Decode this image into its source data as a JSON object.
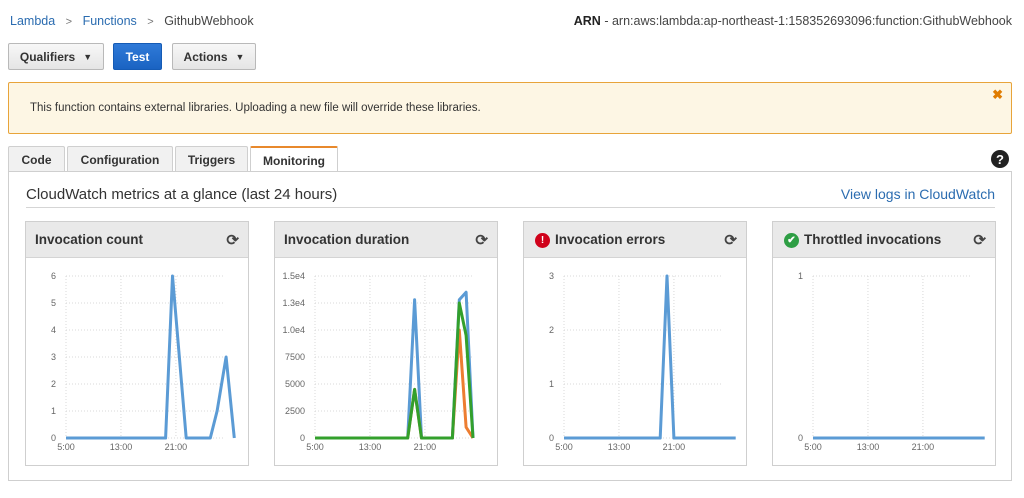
{
  "breadcrumb": {
    "items": [
      "Lambda",
      "Functions",
      "GithubWebhook"
    ]
  },
  "arn": {
    "label": "ARN",
    "value": " - arn:aws:lambda:ap-northeast-1:158352693096:function:GithubWebhook"
  },
  "toolbar": {
    "qualifiers_label": "Qualifiers",
    "test_label": "Test",
    "actions_label": "Actions"
  },
  "alert": {
    "message": "This function contains external libraries. Uploading a new file will override these libraries.",
    "close_glyph": "✖"
  },
  "tabs": [
    {
      "label": "Code",
      "active": false
    },
    {
      "label": "Configuration",
      "active": false
    },
    {
      "label": "Triggers",
      "active": false
    },
    {
      "label": "Monitoring",
      "active": true
    }
  ],
  "help_glyph": "?",
  "monitoring": {
    "title": "CloudWatch metrics at a glance (last 24 hours)",
    "logs_link": "View logs in CloudWatch"
  },
  "colors": {
    "blue": "#5b9bd5",
    "orange": "#ed7d31",
    "green": "#33a02c",
    "accent": "#e8892c"
  },
  "chart_data": [
    {
      "type": "line",
      "title": "Invocation count",
      "status_icon": null,
      "refresh_icon": "refresh-icon",
      "ylim": [
        0,
        6
      ],
      "y_ticks": [
        0,
        1,
        2,
        3,
        4,
        5,
        6
      ],
      "y_tick_labels": [
        "0",
        "1",
        "2",
        "3",
        "4",
        "5",
        "6"
      ],
      "x_ticks": [
        "5:00",
        "13:00",
        "21:00"
      ],
      "x_tick_hours": [
        5,
        13,
        21
      ],
      "xlim": [
        5,
        28
      ],
      "series": [
        {
          "color": "#5b9bd5",
          "x": [
            5,
            10,
            14.5,
            19.5,
            20.5,
            22.5,
            26,
            27,
            28.3,
            29.5
          ],
          "y": [
            0,
            0,
            0,
            0,
            6,
            0,
            0,
            1,
            3,
            0
          ]
        }
      ]
    },
    {
      "type": "line",
      "title": "Invocation duration",
      "status_icon": null,
      "refresh_icon": "refresh-icon",
      "ylim": [
        0,
        15000
      ],
      "y_ticks": [
        0,
        2500,
        5000,
        7500,
        10000,
        12500,
        15000
      ],
      "y_tick_labels": [
        "0",
        "2500",
        "5000",
        "7500",
        "1.0e4",
        "1.3e4",
        "1.5e4"
      ],
      "x_ticks": [
        "5:00",
        "13:00",
        "21:00"
      ],
      "x_tick_hours": [
        5,
        13,
        21
      ],
      "xlim": [
        5,
        28
      ],
      "series": [
        {
          "color": "#5b9bd5",
          "x": [
            5,
            12,
            18.5,
            19.5,
            20.5,
            25,
            26,
            27,
            28
          ],
          "y": [
            0,
            0,
            0,
            12800,
            0,
            0,
            12800,
            13500,
            0
          ]
        },
        {
          "color": "#ed7d31",
          "x": [
            5,
            12,
            18.5,
            19.5,
            20.5,
            25,
            26,
            27,
            28
          ],
          "y": [
            0,
            0,
            0,
            4500,
            0,
            0,
            10000,
            1000,
            0
          ]
        },
        {
          "color": "#33a02c",
          "x": [
            5,
            12,
            18.5,
            19.5,
            20.5,
            25,
            26,
            27,
            28
          ],
          "y": [
            0,
            0,
            0,
            4500,
            0,
            0,
            12500,
            9500,
            0
          ]
        }
      ]
    },
    {
      "type": "line",
      "title": "Invocation errors",
      "status_icon": "error",
      "status_glyph": "!",
      "refresh_icon": "refresh-icon",
      "ylim": [
        0,
        3
      ],
      "y_ticks": [
        0,
        1,
        2,
        3
      ],
      "y_tick_labels": [
        "0",
        "1",
        "2",
        "3"
      ],
      "x_ticks": [
        "5:00",
        "13:00",
        "21:00"
      ],
      "x_tick_hours": [
        5,
        13,
        21
      ],
      "xlim": [
        5,
        28
      ],
      "series": [
        {
          "color": "#5b9bd5",
          "x": [
            5,
            12,
            19,
            20,
            21,
            25,
            30
          ],
          "y": [
            0,
            0,
            0,
            3,
            0,
            0,
            0
          ]
        }
      ]
    },
    {
      "type": "line",
      "title": "Throttled invocations",
      "status_icon": "ok",
      "status_glyph": "✔",
      "refresh_icon": "refresh-icon",
      "ylim": [
        0,
        1
      ],
      "y_ticks": [
        0,
        1
      ],
      "y_tick_labels": [
        "0",
        "1"
      ],
      "x_ticks": [
        "5:00",
        "13:00",
        "21:00"
      ],
      "x_tick_hours": [
        5,
        13,
        21
      ],
      "xlim": [
        5,
        28
      ],
      "series": [
        {
          "color": "#5b9bd5",
          "x": [
            5,
            30
          ],
          "y": [
            0,
            0
          ]
        }
      ]
    }
  ]
}
